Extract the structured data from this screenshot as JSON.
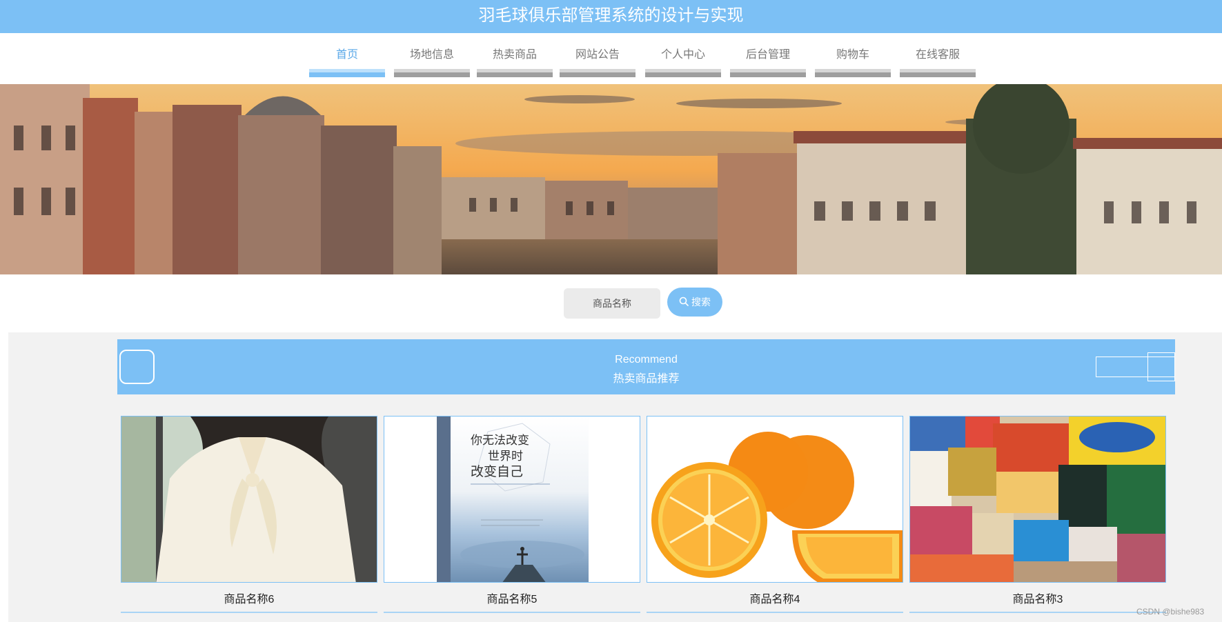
{
  "site": {
    "title": "羽毛球俱乐部管理系统的设计与实现"
  },
  "nav": {
    "items": [
      {
        "label": "首页",
        "active": true
      },
      {
        "label": "场地信息",
        "active": false
      },
      {
        "label": "热卖商品",
        "active": false
      },
      {
        "label": "网站公告",
        "active": false
      },
      {
        "label": "个人中心",
        "active": false
      },
      {
        "label": "后台管理",
        "active": false
      },
      {
        "label": "购物车",
        "active": false
      },
      {
        "label": "在线客服",
        "active": false
      }
    ]
  },
  "search": {
    "placeholder": "商品名称",
    "button_label": "搜索",
    "button_icon": "search-icon"
  },
  "recommend": {
    "title_en": "Recommend",
    "title_cn": "热卖商品推荐"
  },
  "products": [
    {
      "name": "商品名称6",
      "image": "white blouse"
    },
    {
      "name": "商品名称5",
      "image": "book cover"
    },
    {
      "name": "商品名称4",
      "image": "oranges"
    },
    {
      "name": "商品名称3",
      "image": "snack assortment"
    }
  ],
  "book_cover": {
    "title_lines": [
      "你无法改变",
      "世界时",
      "改变自己"
    ]
  },
  "watermark": "CSDN @bishe983",
  "colors": {
    "accent": "#7cc0f5",
    "nav_bar": "#9e9e9e",
    "section_bg": "#f2f2f2"
  }
}
